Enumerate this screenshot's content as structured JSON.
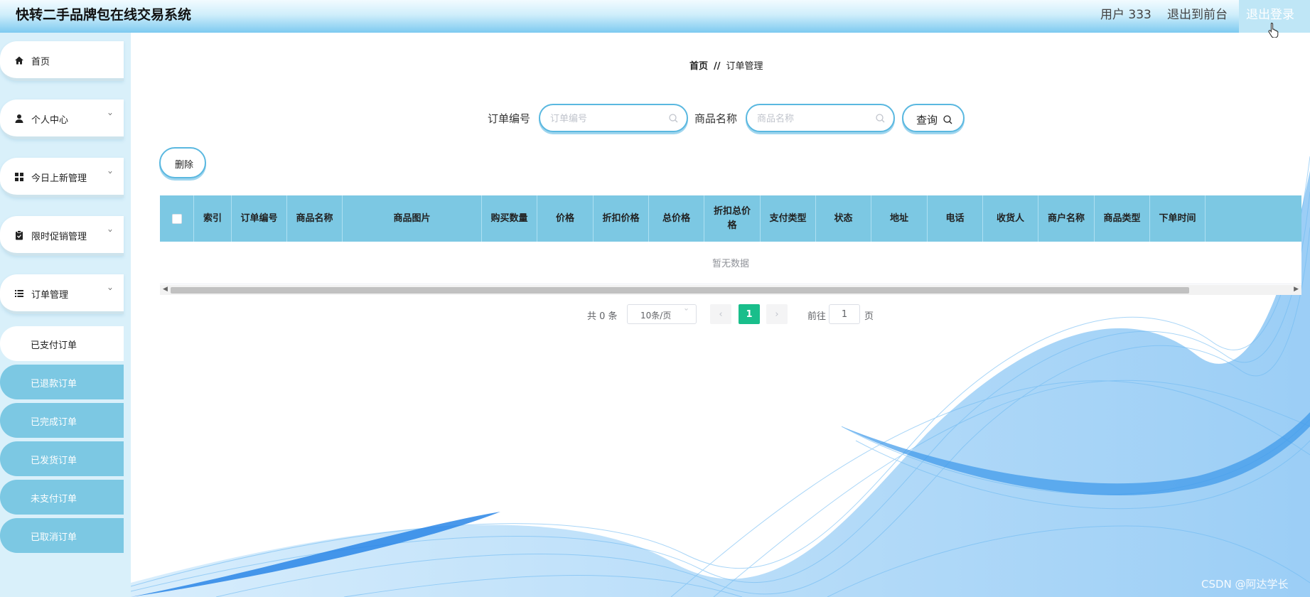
{
  "header": {
    "title": "快转二手品牌包在线交易系统",
    "user": "用户 333",
    "front": "退出到前台",
    "logout": "退出登录"
  },
  "sidebar": {
    "items": [
      {
        "label": "首页",
        "icon": "home-icon"
      },
      {
        "label": "个人中心",
        "icon": "user-icon"
      },
      {
        "label": "今日上新管理",
        "icon": "grid-icon"
      },
      {
        "label": "限时促销管理",
        "icon": "clipboard-icon"
      },
      {
        "label": "订单管理",
        "icon": "list-icon"
      }
    ],
    "sub_items": [
      {
        "label": "已支付订单",
        "active": true
      },
      {
        "label": "已退款订单",
        "active": false
      },
      {
        "label": "已完成订单",
        "active": false
      },
      {
        "label": "已发货订单",
        "active": false
      },
      {
        "label": "未支付订单",
        "active": false
      },
      {
        "label": "已取消订单",
        "active": false
      }
    ]
  },
  "breadcrumb": {
    "home": "首页",
    "separator": "//",
    "current": "订单管理"
  },
  "search": {
    "order_no_label": "订单编号",
    "order_no_placeholder": "订单编号",
    "product_label": "商品名称",
    "product_placeholder": "商品名称",
    "query_label": "查询"
  },
  "actions": {
    "delete_label": "删除"
  },
  "table": {
    "columns": [
      "索引",
      "订单编号",
      "商品名称",
      "商品图片",
      "购买数量",
      "价格",
      "折扣价格",
      "总价格",
      "折扣总价格",
      "支付类型",
      "状态",
      "地址",
      "电话",
      "收货人",
      "商户名称",
      "商品类型",
      "下单时间"
    ],
    "empty_text": "暂无数据"
  },
  "pagination": {
    "total": "共 0 条",
    "page_size": "10条/页",
    "current_page": "1",
    "goto_label": "前往",
    "goto_value": "1",
    "page_suffix": "页"
  },
  "watermark": "CSDN @阿达学长",
  "colors": {
    "accent": "#7cc8e3",
    "active_page": "#19be8b"
  }
}
